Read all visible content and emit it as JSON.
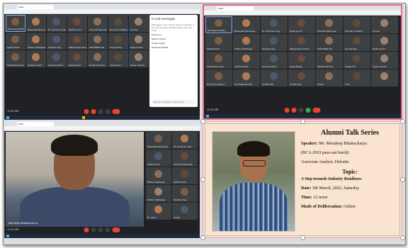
{
  "meet": {
    "window_tab": "Meet – ",
    "time_label": "12:21 PM",
    "meeting_code": "mbc-rwwg-rxx",
    "chat": {
      "title": "In-call messages",
      "info": "Messages can only be seen by people in the call and are deleted when the call ends",
      "messages": [
        {
          "sender": "Everyone",
          "text": ""
        },
        {
          "sender": "Nahan Ghosh",
          "text": ""
        },
        {
          "sender": "Ahash Sagar",
          "text": ""
        },
        {
          "sender": "Moudeep Bhatt",
          "text": ""
        }
      ],
      "input_placeholder": "Send a message to everyone"
    },
    "participants": [
      "Moudeep Bhatta..",
      "Biswadeb Benerjee..",
      "Dr. Krishnan Dey",
      "Rajib Kundu",
      "Saurabh Banerjee",
      "Rounak Chatterji",
      "Sourav",
      "Ipshita Dutt",
      "Pritha Chatterjee",
      "Kaushik Dey",
      "Mahasweta Ghosh",
      "MOLINDRA UR",
      "Suvojit Dey",
      "Rajib Kundu",
      "Subhadeep Das",
      "Ankita Ghosh",
      "Abhirup Sinha",
      "Rupa Basak",
      "Ranjit Chandra",
      "Sneha Giri",
      "Sayan Ghosh",
      "Priya Chowdhury",
      "Soumabrata Das",
      "Anikat Das",
      "Anikat Das",
      "Pinaki",
      "Tina",
      ""
    ],
    "q3_self_name": "Moudeep Bhattacharya",
    "q3_side": [
      "Biswadeb Benerjee",
      "Dr. Krishnan Dey",
      "Rajib Kundu",
      "Saurabh Banerjee",
      "Ritika Chatterjee",
      "Ipshita Dutt",
      "Pritha Chatterjee",
      "Kaushik Dey",
      "Dr. Afroz",
      "Anikat"
    ]
  },
  "poster": {
    "title": "Alumni Talk Series",
    "speaker_label": "Speaker:",
    "speaker_name": "Mr. Moudeep Bhattacharya",
    "batch": "(BCA 2019 pass-out batch)",
    "role": "Associate Analyst, Deloitte",
    "topic_label": "Topic:",
    "topic": "A Step towards Industry Readiness",
    "date_label": "Date:",
    "date": "5th March, 2022, Saturday",
    "time_label": "Time:",
    "time": "12 noon",
    "mode_label": "Mode of Deliberation:",
    "mode": "Online"
  },
  "colors": {
    "meet_bg": "#202124",
    "end_call": "#ea4335",
    "poster_bg": "#fbe4cf",
    "highlight_border": "#e06a80"
  }
}
